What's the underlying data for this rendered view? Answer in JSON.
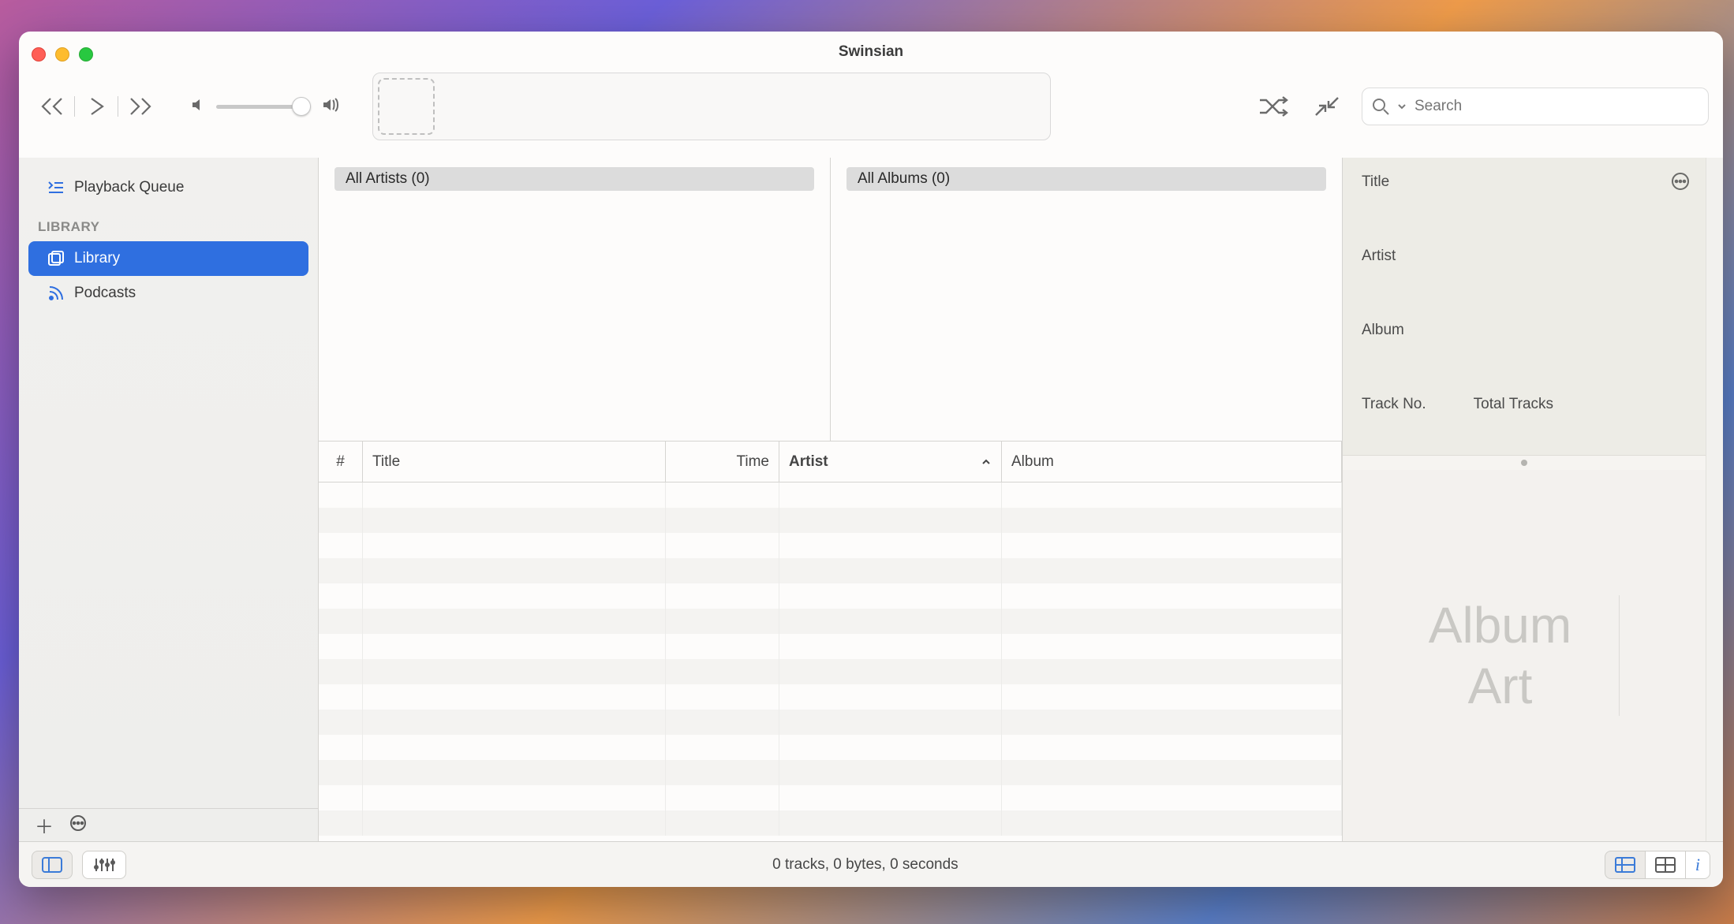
{
  "app": {
    "title": "Swinsian"
  },
  "toolbar": {
    "search_placeholder": "Search"
  },
  "sidebar": {
    "queue_label": "Playback Queue",
    "section_label": "LIBRARY",
    "library_label": "Library",
    "podcasts_label": "Podcasts"
  },
  "browser": {
    "artists_label": "All Artists (0)",
    "albums_label": "All Albums (0)"
  },
  "columns": {
    "num": "#",
    "title": "Title",
    "time": "Time",
    "artist": "Artist",
    "album": "Album"
  },
  "inspector": {
    "title_label": "Title",
    "artist_label": "Artist",
    "album_label": "Album",
    "trackno_label": "Track No.",
    "total_tracks_label": "Total Tracks",
    "art_placeholder_l1": "Album",
    "art_placeholder_l2": "Art"
  },
  "footer": {
    "status": "0 tracks,  0 bytes,  0 seconds"
  }
}
